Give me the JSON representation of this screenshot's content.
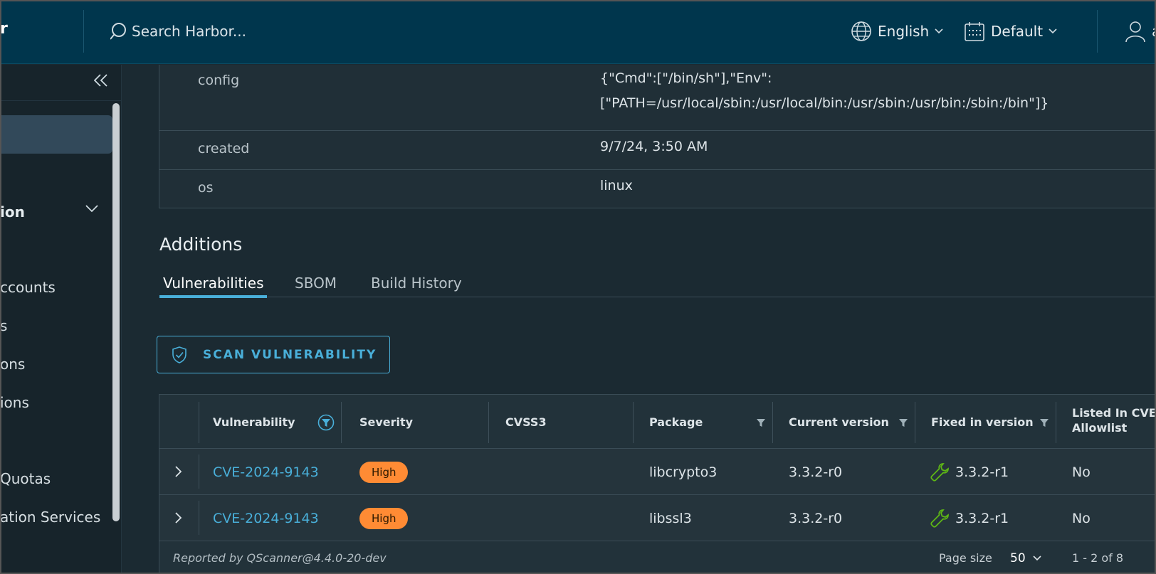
{
  "header": {
    "brand": "r",
    "search_placeholder": "Search Harbor...",
    "language": "English",
    "theme": "Default",
    "user": "a"
  },
  "sidebar": {
    "items": [
      {
        "label": "ion",
        "group": true
      },
      {
        "label": "ccounts"
      },
      {
        "label": "s"
      },
      {
        "label": "ons"
      },
      {
        "label": "ions"
      },
      {
        "label": "Quotas"
      },
      {
        "label": "ation Services"
      }
    ]
  },
  "properties": [
    {
      "key": "config",
      "value_line1": "{\"Cmd\":[\"/bin/sh\"],\"Env\":",
      "value_line2": "[\"PATH=/usr/local/sbin:/usr/local/bin:/usr/sbin:/usr/bin:/sbin:/bin\"]}"
    },
    {
      "key": "created",
      "value_line1": "9/7/24, 3:50 AM"
    },
    {
      "key": "os",
      "value_line1": "linux"
    }
  ],
  "additions": {
    "title": "Additions",
    "tabs": [
      "Vulnerabilities",
      "SBOM",
      "Build History"
    ],
    "active_tab": "Vulnerabilities",
    "scan_button": "SCAN VULNERABILITY"
  },
  "grid": {
    "columns": [
      "Vulnerability",
      "Severity",
      "CVSS3",
      "Package",
      "Current version",
      "Fixed in version",
      "Listed In CVE",
      "Allowlist"
    ],
    "rows": [
      {
        "vulnerability": "CVE-2024-9143",
        "severity": "High",
        "cvss3": "",
        "package": "libcrypto3",
        "current": "3.3.2-r0",
        "fixed": "3.3.2-r1",
        "allowlist": "No"
      },
      {
        "vulnerability": "CVE-2024-9143",
        "severity": "High",
        "cvss3": "",
        "package": "libssl3",
        "current": "3.3.2-r0",
        "fixed": "3.3.2-r1",
        "allowlist": "No"
      }
    ],
    "footer": {
      "reported_by": "Reported by QScanner@4.4.0-20-dev",
      "page_size_label": "Page size",
      "page_size": "50",
      "count": "1 - 2 of 8"
    }
  },
  "colors": {
    "header_bg": "#00364d",
    "accent": "#49afd9",
    "high": "#ff8b34",
    "fixed_icon": "#5eb715"
  }
}
